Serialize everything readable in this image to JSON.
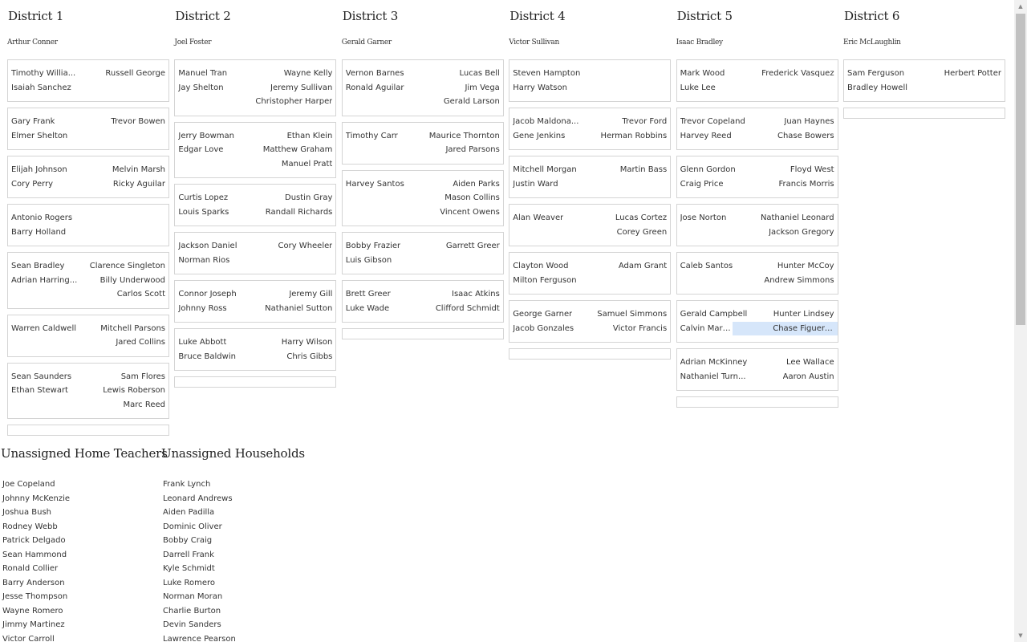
{
  "districts": [
    {
      "title": "District 1",
      "leader": "Arthur Conner",
      "groups": [
        {
          "left": [
            "Timothy Willia...",
            "Isaiah Sanchez"
          ],
          "right": [
            "Russell George"
          ]
        },
        {
          "left": [
            "Gary Frank",
            "Elmer Shelton"
          ],
          "right": [
            "Trevor Bowen"
          ]
        },
        {
          "left": [
            "Elijah Johnson",
            "Cory Perry"
          ],
          "right": [
            "Melvin Marsh",
            "Ricky Aguilar"
          ]
        },
        {
          "left": [
            "Antonio Rogers",
            "Barry Holland"
          ],
          "right": []
        },
        {
          "left": [
            "Sean Bradley",
            "Adrian Harring..."
          ],
          "right": [
            "Clarence Singleton",
            "Billy Underwood",
            "Carlos Scott"
          ]
        },
        {
          "left": [
            "Warren Caldwell"
          ],
          "right": [
            "Mitchell Parsons",
            "Jared Collins"
          ]
        },
        {
          "left": [
            "Sean Saunders",
            "Ethan Stewart"
          ],
          "right": [
            "Sam Flores",
            "Lewis Roberson",
            "Marc Reed"
          ]
        }
      ]
    },
    {
      "title": "District 2",
      "leader": "Joel Foster",
      "groups": [
        {
          "left": [
            "Manuel Tran",
            "Jay Shelton"
          ],
          "right": [
            "Wayne Kelly",
            "Jeremy Sullivan",
            "Christopher Harper"
          ]
        },
        {
          "left": [
            "Jerry Bowman",
            "Edgar Love"
          ],
          "right": [
            "Ethan Klein",
            "Matthew Graham",
            "Manuel Pratt"
          ]
        },
        {
          "left": [
            "Curtis Lopez",
            "Louis Sparks"
          ],
          "right": [
            "Dustin Gray",
            "Randall Richards"
          ]
        },
        {
          "left": [
            "Jackson Daniel",
            "Norman Rios"
          ],
          "right": [
            "Cory Wheeler"
          ]
        },
        {
          "left": [
            "Connor Joseph",
            "Johnny Ross"
          ],
          "right": [
            "Jeremy Gill",
            "Nathaniel Sutton"
          ]
        },
        {
          "left": [
            "Luke Abbott",
            "Bruce Baldwin"
          ],
          "right": [
            "Harry Wilson",
            "Chris Gibbs"
          ]
        }
      ]
    },
    {
      "title": "District 3",
      "leader": "Gerald Garner",
      "groups": [
        {
          "left": [
            "Vernon Barnes",
            "Ronald Aguilar"
          ],
          "right": [
            "Lucas Bell",
            "Jim Vega",
            "Gerald Larson"
          ]
        },
        {
          "left": [
            "Timothy Carr"
          ],
          "right": [
            "Maurice Thornton",
            "Jared Parsons"
          ]
        },
        {
          "left": [
            "Harvey Santos"
          ],
          "right": [
            "Aiden Parks",
            "Mason Collins",
            "Vincent Owens"
          ]
        },
        {
          "left": [
            "Bobby Frazier",
            "Luis Gibson"
          ],
          "right": [
            "Garrett Greer"
          ]
        },
        {
          "left": [
            "Brett Greer",
            "Luke Wade"
          ],
          "right": [
            "Isaac Atkins",
            "Clifford Schmidt"
          ]
        }
      ]
    },
    {
      "title": "District 4",
      "leader": "Victor Sullivan",
      "groups": [
        {
          "left": [
            "Steven Hampton",
            "Harry Watson"
          ],
          "right": []
        },
        {
          "left": [
            "Jacob Maldona...",
            "Gene Jenkins"
          ],
          "right": [
            "Trevor Ford",
            "Herman Robbins"
          ]
        },
        {
          "left": [
            "Mitchell Morgan",
            "Justin Ward"
          ],
          "right": [
            "Martin Bass"
          ]
        },
        {
          "left": [
            "Alan Weaver"
          ],
          "right": [
            "Lucas Cortez",
            "Corey Green"
          ]
        },
        {
          "left": [
            "Clayton Wood",
            "Milton Ferguson"
          ],
          "right": [
            "Adam Grant"
          ]
        },
        {
          "left": [
            "George Garner",
            "Jacob Gonzales"
          ],
          "right": [
            "Samuel Simmons",
            "Victor Francis"
          ]
        }
      ]
    },
    {
      "title": "District 5",
      "leader": "Isaac Bradley",
      "groups": [
        {
          "left": [
            "Mark Wood",
            "Luke Lee"
          ],
          "right": [
            "Frederick Vasquez"
          ]
        },
        {
          "left": [
            "Trevor Copeland",
            "Harvey Reed"
          ],
          "right": [
            "Juan Haynes",
            "Chase Bowers"
          ]
        },
        {
          "left": [
            "Glenn Gordon",
            "Craig Price"
          ],
          "right": [
            "Floyd West",
            "Francis Morris"
          ]
        },
        {
          "left": [
            "Jose Norton"
          ],
          "right": [
            "Nathaniel Leonard",
            "Jackson Gregory"
          ]
        },
        {
          "left": [
            "Caleb Santos"
          ],
          "right": [
            "Hunter McCoy",
            "Andrew Simmons"
          ]
        },
        {
          "left": [
            "Gerald Campbell",
            "Calvin Martin"
          ],
          "right": [
            "Hunter Lindsey",
            "Chase Figueroa"
          ],
          "highlight_right": 1
        },
        {
          "left": [
            "Adrian McKinney",
            "Nathaniel Turn..."
          ],
          "right": [
            "Lee Wallace",
            "Aaron Austin"
          ]
        }
      ]
    },
    {
      "title": "District 6",
      "leader": "Eric McLaughlin",
      "groups": [
        {
          "left": [
            "Sam Ferguson",
            "Bradley Howell"
          ],
          "right": [
            "Herbert Potter"
          ]
        }
      ]
    }
  ],
  "unassigned_teachers": {
    "title": "Unassigned Home Teachers",
    "items": [
      "Joe Copeland",
      "Johnny McKenzie",
      "Joshua Bush",
      "Rodney Webb",
      "Patrick Delgado",
      "Sean Hammond",
      "Ronald Collier",
      "Barry Anderson",
      "Jesse Thompson",
      "Wayne Romero",
      "Jimmy Martinez",
      "Victor Carroll"
    ]
  },
  "unassigned_households": {
    "title": "Unassigned Households",
    "items": [
      "Frank Lynch",
      "Leonard Andrews",
      "Aiden Padilla",
      "Dominic Oliver",
      "Bobby Craig",
      "Darrell Frank",
      "Kyle Schmidt",
      "Luke Romero",
      "Norman Moran",
      "Charlie Burton",
      "Devin Sanders",
      "Lawrence Pearson"
    ]
  },
  "scrollbar": {
    "up_icon": "▲",
    "down_icon": "▼"
  }
}
